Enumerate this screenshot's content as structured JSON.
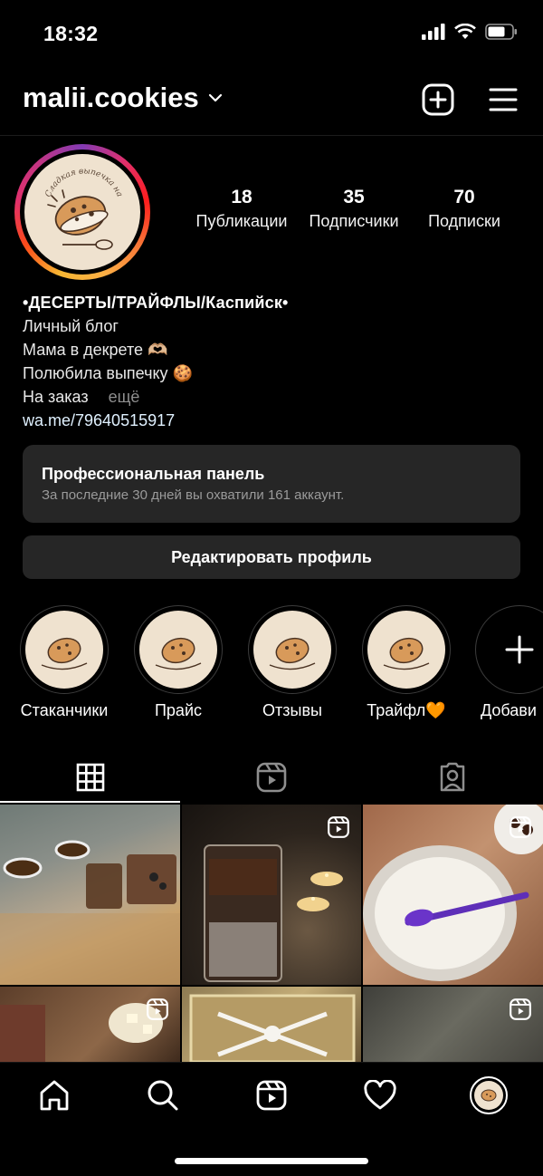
{
  "status": {
    "time": "18:32"
  },
  "header": {
    "username": "malii.cookies"
  },
  "stats": [
    {
      "value": "18",
      "label": "Публикации"
    },
    {
      "value": "35",
      "label": "Подписчики"
    },
    {
      "value": "70",
      "label": "Подписки"
    }
  ],
  "bio": {
    "name": "•ДЕСЕРТЫ/ТРАЙФЛЫ/Каспийск•",
    "lines": [
      "Личный блог",
      "Мама в декрете 🫶🏼",
      "Полюбила выпечку 🍪",
      "На заказ"
    ],
    "more": "ещё",
    "link": "wa.me/79640515917"
  },
  "pro_panel": {
    "title": "Профессиональная панель",
    "subtitle": "За последние 30 дней вы охватили 161 аккаунт."
  },
  "edit_profile": "Редактировать профиль",
  "highlights": [
    {
      "label": "Стаканчики"
    },
    {
      "label": "Прайс"
    },
    {
      "label": "Отзывы"
    },
    {
      "label": "Трайфл🧡"
    },
    {
      "label": "Добави"
    }
  ],
  "logo_text": "Сладкая выпечка на заказ",
  "colors": {
    "accent": "#e1306c",
    "panel": "#262626",
    "logo_bg": "#efe2cf"
  }
}
